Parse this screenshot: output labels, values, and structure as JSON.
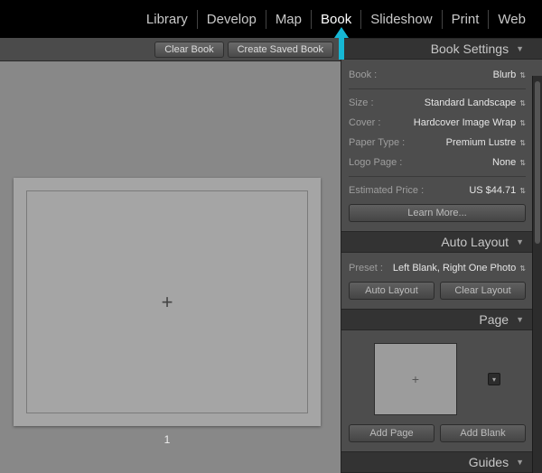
{
  "modules": {
    "library": "Library",
    "develop": "Develop",
    "map": "Map",
    "book": "Book",
    "slideshow": "Slideshow",
    "print": "Print",
    "web": "Web"
  },
  "toolbar": {
    "clear_book": "Clear Book",
    "create_saved_book": "Create Saved Book"
  },
  "preview": {
    "page_number": "1"
  },
  "panels": {
    "book_settings": {
      "title": "Book Settings",
      "fields": {
        "book_label": "Book :",
        "book_value": "Blurb",
        "size_label": "Size :",
        "size_value": "Standard Landscape",
        "cover_label": "Cover :",
        "cover_value": "Hardcover Image Wrap",
        "paper_label": "Paper Type :",
        "paper_value": "Premium Lustre",
        "logo_label": "Logo Page :",
        "logo_value": "None",
        "price_label": "Estimated Price :",
        "price_value": "US $44.71"
      },
      "learn_more": "Learn More..."
    },
    "auto_layout": {
      "title": "Auto Layout",
      "preset_label": "Preset :",
      "preset_value": "Left Blank, Right One Photo",
      "auto_layout_btn": "Auto Layout",
      "clear_layout_btn": "Clear Layout"
    },
    "page": {
      "title": "Page",
      "add_page": "Add Page",
      "add_blank": "Add Blank"
    },
    "guides": {
      "title": "Guides"
    }
  }
}
